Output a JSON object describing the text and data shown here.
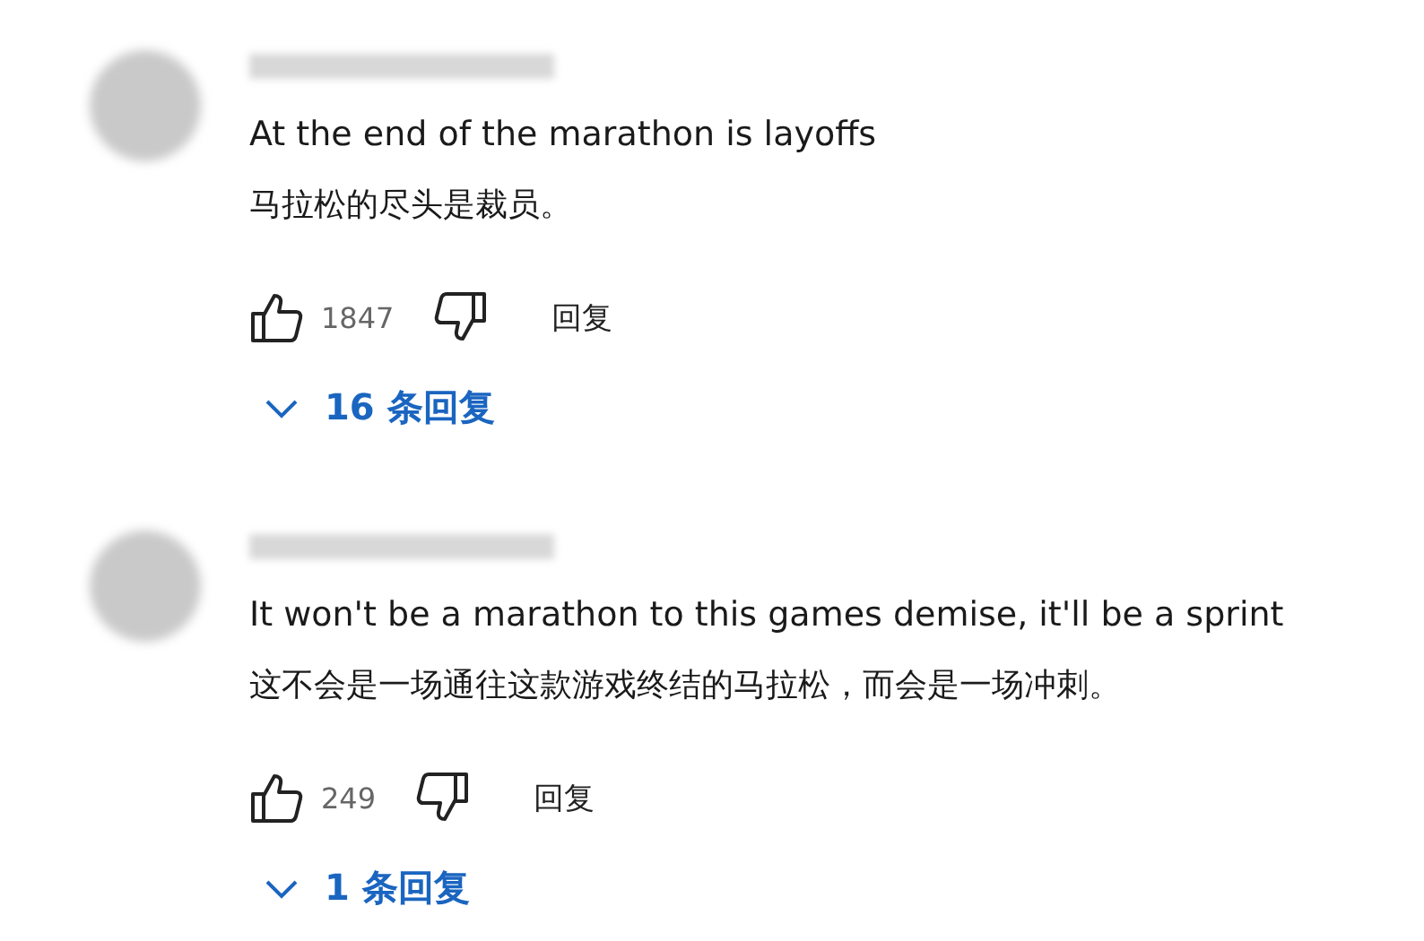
{
  "comments": [
    {
      "text": "At the end of the marathon is layoffs",
      "translation": "马拉松的尽头是裁员。",
      "likes": "1847",
      "reply_label": "回复",
      "replies": "16 条回复"
    },
    {
      "text": "It won't be a marathon to this games demise, it'll be a sprint",
      "translation": "这不会是一场通往这款游戏终结的马拉松，而会是一场冲刺。",
      "likes": "249",
      "reply_label": "回复",
      "replies": "1 条回复"
    }
  ]
}
